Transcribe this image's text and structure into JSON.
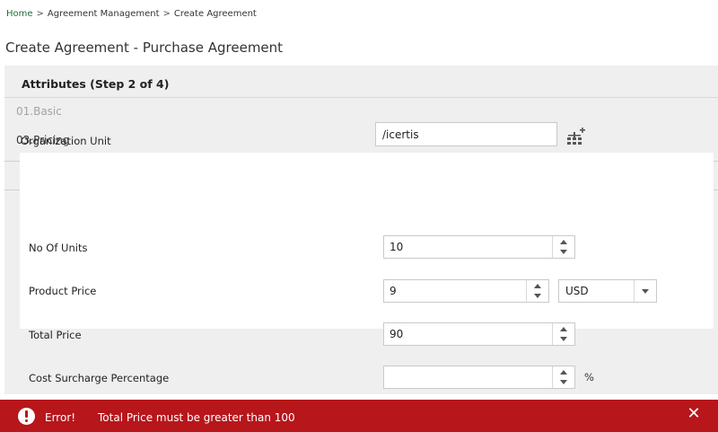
{
  "breadcrumb": {
    "home": "Home",
    "separator": ">",
    "item1": "Agreement Management",
    "item2": "Create Agreement"
  },
  "page_title": "Create Agreement - Purchase Agreement",
  "step_header": "Attributes (Step 2 of 4)",
  "organization": {
    "label": "Organization Unit",
    "value": "/icertis",
    "picker_icon": "hierarchy-add-icon"
  },
  "sections": {
    "basic": "01.Basic",
    "pricing": "03.Pricing"
  },
  "pricing": {
    "units_label": "No Of Units",
    "units_value": "10",
    "price_label": "Product Price",
    "price_value": "9",
    "currency_value": "USD",
    "total_label": "Total Price",
    "total_value": "90",
    "surcharge_label": "Cost Surcharge Percentage",
    "surcharge_value": "",
    "percent_suffix": "%"
  },
  "error": {
    "label": "Error!",
    "message": "Total Price must be greater than 100",
    "close": "✕"
  },
  "colors": {
    "error_bar": "#b7161b",
    "breadcrumb_link": "#1f6f3a",
    "panel_bg": "#efefef"
  }
}
